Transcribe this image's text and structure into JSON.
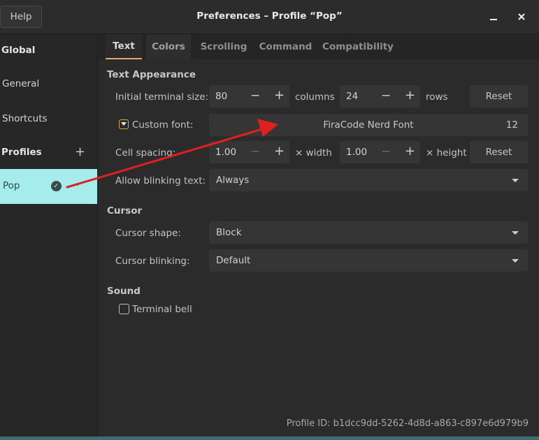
{
  "window": {
    "title": "Preferences – Profile “Pop”",
    "help_label": "Help",
    "minimize_icon": "minimize-icon",
    "close_icon": "close-icon"
  },
  "sidebar": {
    "global_heading": "Global",
    "items": [
      {
        "label": "General"
      },
      {
        "label": "Shortcuts"
      }
    ],
    "profiles_heading": "Profiles",
    "profiles": [
      {
        "label": "Pop",
        "selected": true,
        "default": true
      }
    ]
  },
  "tabs": [
    {
      "label": "Text",
      "active": true
    },
    {
      "label": "Colors"
    },
    {
      "label": "Scrolling"
    },
    {
      "label": "Command"
    },
    {
      "label": "Compatibility"
    }
  ],
  "text_appearance": {
    "heading": "Text Appearance",
    "initial_size_label": "Initial terminal size:",
    "columns": "80",
    "columns_unit": "columns",
    "rows": "24",
    "rows_unit": "rows",
    "reset_label": "Reset",
    "custom_font_label": "Custom font:",
    "custom_font_checked": true,
    "font_name": "FiraCode Nerd Font",
    "font_size": "12",
    "cell_spacing_label": "Cell spacing:",
    "width_value": "1.00",
    "width_unit": "× width",
    "height_value": "1.00",
    "height_unit": "× height",
    "reset2_label": "Reset",
    "blink_label": "Allow blinking text:",
    "blink_value": "Always"
  },
  "cursor": {
    "heading": "Cursor",
    "shape_label": "Cursor shape:",
    "shape_value": "Block",
    "blinking_label": "Cursor blinking:",
    "blinking_value": "Default"
  },
  "sound": {
    "heading": "Sound",
    "bell_label": "Terminal bell",
    "bell_checked": false
  },
  "footer": {
    "profile_id": "Profile ID:  b1dcc9dd-5262-4d8d-a863-c897e6d979b9"
  },
  "colors": {
    "accent": "#e0a96d",
    "selected_profile_bg": "#a7ecec",
    "annotation_arrow": "#e02020"
  }
}
